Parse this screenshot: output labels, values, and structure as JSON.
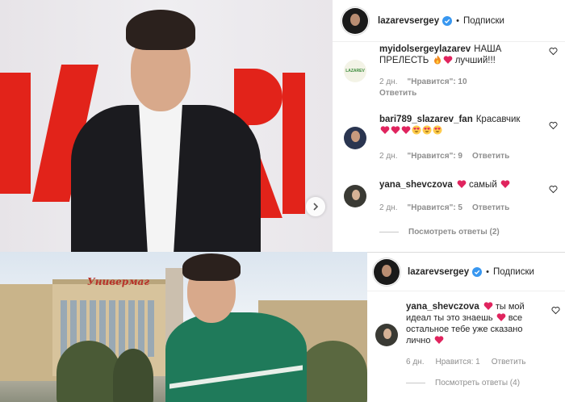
{
  "top_post": {
    "header": {
      "username": "lazarevsergey",
      "separator": "•",
      "follow_label": "Подписки"
    },
    "comments": [
      {
        "username": "myidolsergeylazarev",
        "text": "НАША ПРЕЛЕСТЬ",
        "emoji": [
          "fire",
          "heart"
        ],
        "text_after": " лучший!!!",
        "time": "2 дн.",
        "likes": "\"Нравится\": 10",
        "reply": "Ответить",
        "avatar_label": "LAZAREV"
      },
      {
        "username": "bari789_slazarev_fan",
        "text": "Красавчик",
        "emoji_line": [
          "heart",
          "heart",
          "heart",
          "heart-eyes",
          "heart-eyes",
          "heart-eyes"
        ],
        "time": "2 дн.",
        "likes": "\"Нравится\": 9",
        "reply": "Ответить"
      },
      {
        "username": "yana_shevczova",
        "text_before_emoji": "",
        "text": "самый",
        "time": "2 дн.",
        "likes": "\"Нравится\": 5",
        "reply": "Ответить"
      }
    ],
    "view_replies": "Посмотреть ответы (2)"
  },
  "bottom_post": {
    "header": {
      "username": "lazarevsergey",
      "separator": "•",
      "follow_label": "Подписки"
    },
    "comment": {
      "username": "yana_shevczova",
      "text_1": "ты мой идеал ты это знаешь",
      "text_2": "все остальное тебе уже сказано лично",
      "time": "6 дн.",
      "likes": "Нравится: 1",
      "reply": "Ответить"
    },
    "view_replies": "Посмотреть ответы (4)"
  },
  "photo_top": {
    "backdrop_text": "ARI"
  },
  "photo_bottom": {
    "sign_text": "Универмаг"
  },
  "colors": {
    "heart": "#ed4956",
    "verified": "#3897f0",
    "muted": "#8e8e8e"
  },
  "icons": [
    "chevron-right-icon",
    "verified-badge-icon",
    "like-heart-icon",
    "heart-emoji-icon",
    "fire-emoji-icon",
    "heart-eyes-emoji-icon"
  ]
}
